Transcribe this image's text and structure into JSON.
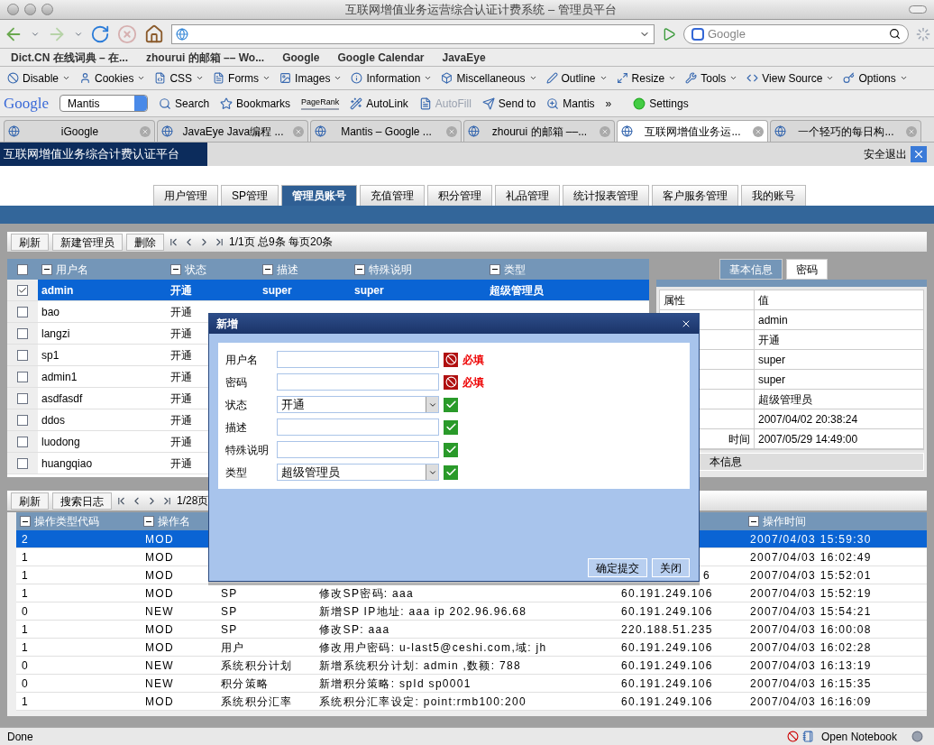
{
  "window": {
    "title": "互联网增值业务运营综合认证计费系统 – 管理员平台"
  },
  "navbar": {
    "search_placeholder": "Google"
  },
  "bookmarks": [
    "Dict.CN 在线词典 – 在...",
    "zhourui 的邮箱 –– Wo...",
    "Google",
    "Google Calendar",
    "JavaEye"
  ],
  "devtools": [
    "Disable",
    "Cookies",
    "CSS",
    "Forms",
    "Images",
    "Information",
    "Miscellaneous",
    "Outline",
    "Resize",
    "Tools",
    "View Source",
    "Options"
  ],
  "googlebar": {
    "logo": "Google",
    "search_value": "Mantis",
    "items": [
      {
        "label": "Search",
        "kind": "search"
      },
      {
        "label": "Bookmarks",
        "kind": "star"
      },
      {
        "label": "PageRank",
        "kind": "rank"
      },
      {
        "label": "AutoLink",
        "kind": "wand"
      },
      {
        "label": "AutoFill",
        "kind": "disabled"
      },
      {
        "label": "Send to",
        "kind": "send"
      },
      {
        "label": "Mantis",
        "kind": "mag"
      },
      {
        "label": "»",
        "kind": "more"
      },
      {
        "label": "Settings",
        "kind": "settings"
      }
    ]
  },
  "tabs": [
    {
      "label": "iGoogle",
      "selected": false
    },
    {
      "label": "JavaEye Java编程 ...",
      "selected": false
    },
    {
      "label": "Mantis – Google ...",
      "selected": false
    },
    {
      "label": "zhourui 的邮箱 ––...",
      "selected": false
    },
    {
      "label": "互联网增值业务运...",
      "selected": true
    },
    {
      "label": "一个轻巧的每日构...",
      "selected": false
    }
  ],
  "page": {
    "header": "互联网增值业务综合计费认证平台",
    "logout": "安全退出",
    "menu": [
      {
        "label": "用户管理",
        "selected": false
      },
      {
        "label": "SP管理",
        "selected": false
      },
      {
        "label": "管理员账号",
        "selected": true
      },
      {
        "label": "充值管理",
        "selected": false
      },
      {
        "label": "积分管理",
        "selected": false
      },
      {
        "label": "礼品管理",
        "selected": false
      },
      {
        "label": "统计报表管理",
        "selected": false
      },
      {
        "label": "客户服务管理",
        "selected": false
      },
      {
        "label": "我的账号",
        "selected": false
      }
    ],
    "toolbar": {
      "buttons": [
        "刷新",
        "新建管理员",
        "删除"
      ],
      "pager": "1/1页 总9条 每页20条"
    },
    "grid": {
      "select_all_checked": false,
      "columns": [
        "用户名",
        "状态",
        "描述",
        "特殊说明",
        "类型"
      ],
      "rows": [
        {
          "username": "admin",
          "status": "开通",
          "desc": "super",
          "special": "super",
          "type": "超级管理员",
          "checked": true,
          "selected": true
        },
        {
          "username": "bao",
          "status": "开通",
          "checked": false,
          "selected": false
        },
        {
          "username": "langzi",
          "status": "开通",
          "checked": false,
          "selected": false
        },
        {
          "username": "sp1",
          "status": "开通",
          "checked": false,
          "selected": false
        },
        {
          "username": "admin1",
          "status": "开通",
          "checked": false,
          "selected": false
        },
        {
          "username": "asdfasdf",
          "status": "开通",
          "checked": false,
          "selected": false
        },
        {
          "username": "ddos",
          "status": "开通",
          "checked": false,
          "selected": false
        },
        {
          "username": "luodong",
          "status": "开通",
          "checked": false,
          "selected": false
        },
        {
          "username": "huangqiao",
          "status": "开通",
          "checked": false,
          "selected": false
        }
      ]
    },
    "detail": {
      "tabs": [
        {
          "label": "基本信息",
          "selected": true
        },
        {
          "label": "密码",
          "selected": false
        }
      ],
      "columns": [
        "属性",
        "值"
      ],
      "rows": [
        {
          "value": "admin"
        },
        {
          "value": "开通"
        },
        {
          "value": "super"
        },
        {
          "value": "super"
        },
        {
          "value": "超级管理员"
        },
        {
          "value": "2007/04/02 20:38:24"
        },
        {
          "property": "时间",
          "value": "2007/05/29 14:49:00"
        }
      ],
      "footer": "本信息"
    },
    "log": {
      "buttons": [
        "刷新",
        "搜索日志"
      ],
      "pager": "1/28页",
      "headers": {
        "code": "操作类型代码",
        "name": "操作名",
        "time": "操作时间"
      },
      "rows": [
        {
          "code": "2",
          "name": "MOD",
          "time": "2007/04/03 15:59:30",
          "selected": true
        },
        {
          "code": "1",
          "name": "MOD",
          "time": "2007/04/03 16:02:49",
          "selected": false
        },
        {
          "code": "1",
          "name": "MOD",
          "ip": "6",
          "ip_cut": true,
          "time": "2007/04/03 15:52:01",
          "selected": false
        },
        {
          "code": "1",
          "name": "MOD",
          "target": "SP",
          "detail": "修改SP密码:  aaa",
          "ip": "60.191.249.106",
          "time": "2007/04/03 15:52:19",
          "selected": false
        },
        {
          "code": "0",
          "name": "NEW",
          "target": "SP",
          "detail": "新增SP IP地址:  aaa ip 202.96.96.68",
          "ip": "60.191.249.106",
          "time": "2007/04/03 15:54:21",
          "selected": false
        },
        {
          "code": "1",
          "name": "MOD",
          "target": "SP",
          "detail": "修改SP:  aaa",
          "ip": "220.188.51.235",
          "time": "2007/04/03 16:00:08",
          "selected": false
        },
        {
          "code": "1",
          "name": "MOD",
          "target": "用户",
          "detail": "修改用户密码:  u-last5@ceshi.com,域:  jh",
          "ip": "60.191.249.106",
          "time": "2007/04/03 16:02:28",
          "selected": false
        },
        {
          "code": "0",
          "name": "NEW",
          "target": "系统积分计划",
          "detail": "新增系统积分计划:  admin ,数额:  788",
          "ip": "60.191.249.106",
          "time": "2007/04/03 16:13:19",
          "selected": false
        },
        {
          "code": "0",
          "name": "NEW",
          "target": "积分策略",
          "detail": "新增积分策略: spId sp0001",
          "ip": "60.191.249.106",
          "time": "2007/04/03 16:15:35",
          "selected": false
        },
        {
          "code": "1",
          "name": "MOD",
          "target": "系统积分汇率",
          "detail": "系统积分汇率设定:  point:rmb100:200",
          "ip": "60.191.249.106",
          "time": "2007/04/03 16:16:09",
          "selected": false
        }
      ]
    },
    "dialog": {
      "title": "新增",
      "fields": [
        {
          "label": "用户名",
          "kind": "text",
          "valid": false,
          "hint": "必填"
        },
        {
          "label": "密码",
          "kind": "text",
          "valid": false,
          "hint": "必填"
        },
        {
          "label": "状态",
          "kind": "select",
          "value": "开通",
          "valid": true
        },
        {
          "label": "描述",
          "kind": "text",
          "valid": true
        },
        {
          "label": "特殊说明",
          "kind": "text",
          "valid": true
        },
        {
          "label": "类型",
          "kind": "select",
          "value": "超级管理员",
          "valid": true
        }
      ],
      "buttons": [
        "确定提交",
        "关闭"
      ]
    }
  },
  "status_bar": {
    "text": "Done",
    "notebook": "Open Notebook"
  }
}
